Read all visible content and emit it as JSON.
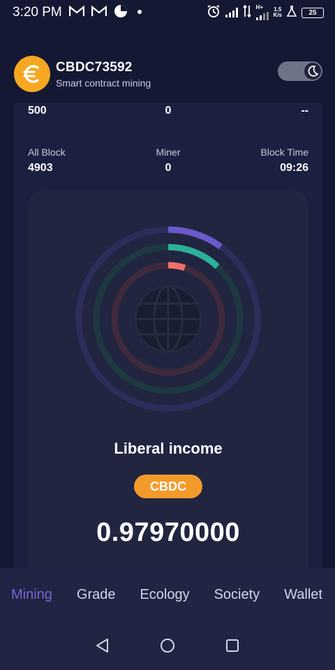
{
  "status_bar": {
    "time": "3:20 PM",
    "network_speed_value": "1.5",
    "network_speed_unit": "K/s",
    "network_type": "H+",
    "battery": "25"
  },
  "header": {
    "title": "CBDC73592",
    "subtitle": "Smart contract mining",
    "logo_icon": "euro-icon",
    "theme_toggle_icon": "moon-icon",
    "dark_mode": true
  },
  "stats_top": {
    "values": [
      "500",
      "0",
      "--"
    ]
  },
  "stats": [
    {
      "label": "All Block",
      "value": "4903"
    },
    {
      "label": "Miner",
      "value": "0"
    },
    {
      "label": "Block Time",
      "value": "09:26"
    }
  ],
  "mining": {
    "rings": [
      {
        "color": "#6a5acd",
        "progress": 0.1
      },
      {
        "color": "#2bb09a",
        "progress": 0.12
      },
      {
        "color": "#f0706a",
        "progress": 0.05
      }
    ],
    "center_icon": "globe-icon",
    "income_label": "Liberal income",
    "currency_badge": "CBDC",
    "amount": "0.97970000"
  },
  "tabs": [
    {
      "label": "Mining",
      "active": true
    },
    {
      "label": "Grade",
      "active": false
    },
    {
      "label": "Ecology",
      "active": false
    },
    {
      "label": "Society",
      "active": false
    },
    {
      "label": "Wallet",
      "active": false
    }
  ],
  "colors": {
    "background": "#141833",
    "accent": "#7b64d8",
    "logo": "#f7a823",
    "badge": "#f49a2a"
  }
}
